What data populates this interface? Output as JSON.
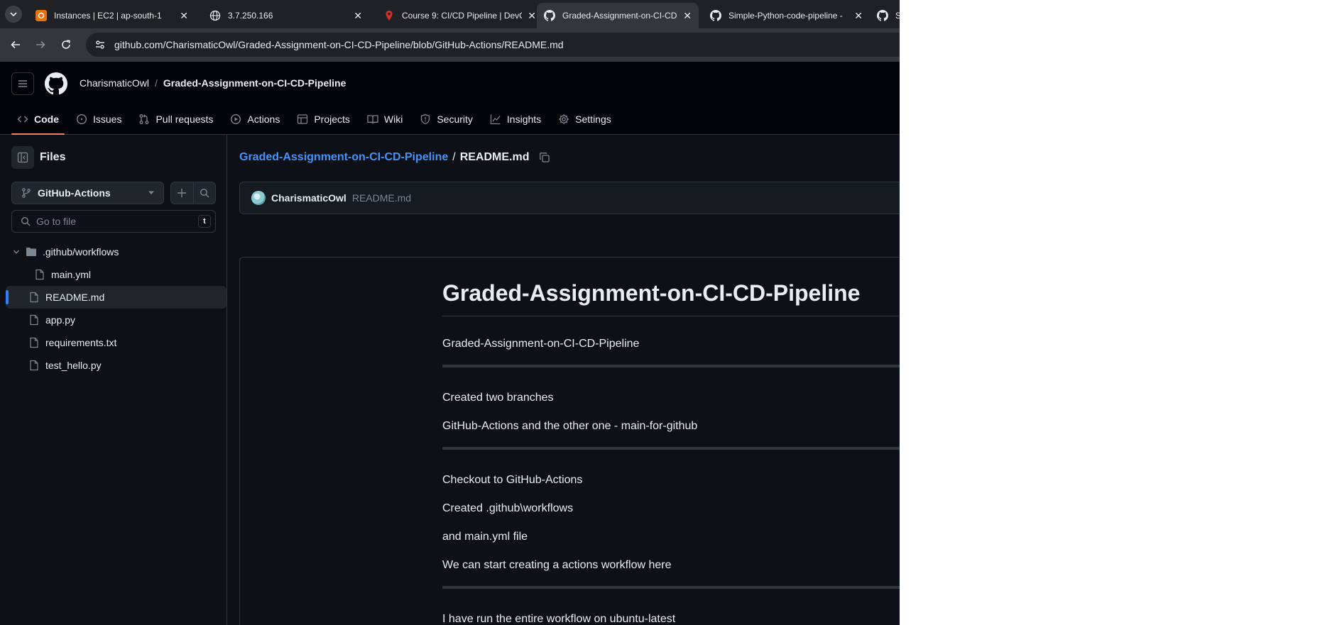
{
  "browser": {
    "tabs": [
      {
        "title": "Instances | EC2 | ap-south-1",
        "favicon": "aws-icon",
        "active": false
      },
      {
        "title": "3.7.250.166",
        "favicon": "globe-icon",
        "active": false
      },
      {
        "title": "Course 9: CI/CD Pipeline | DevO",
        "favicon": "pin-icon",
        "active": false
      },
      {
        "title": "Graded-Assignment-on-CI-CD-",
        "favicon": "github-icon",
        "active": true
      },
      {
        "title": "Simple-Python-code-pipeline -",
        "favicon": "github-icon",
        "active": false
      },
      {
        "title": "Si",
        "favicon": "github-icon",
        "active": false
      }
    ],
    "url": "github.com/CharismaticOwl/Graded-Assignment-on-CI-CD-Pipeline/blob/GitHub-Actions/README.md"
  },
  "header": {
    "owner": "CharismaticOwl",
    "separator": "/",
    "repo": "Graded-Assignment-on-CI-CD-Pipeline"
  },
  "nav": [
    {
      "label": "Code",
      "icon": "code-icon",
      "selected": true
    },
    {
      "label": "Issues",
      "icon": "issue-icon"
    },
    {
      "label": "Pull requests",
      "icon": "pull-request-icon"
    },
    {
      "label": "Actions",
      "icon": "play-icon"
    },
    {
      "label": "Projects",
      "icon": "table-icon"
    },
    {
      "label": "Wiki",
      "icon": "book-icon"
    },
    {
      "label": "Security",
      "icon": "shield-icon"
    },
    {
      "label": "Insights",
      "icon": "graph-icon"
    },
    {
      "label": "Settings",
      "icon": "gear-icon"
    }
  ],
  "sidebar": {
    "title": "Files",
    "branch": "GitHub-Actions",
    "search_placeholder": "Go to file",
    "search_shortcut": "t",
    "tree": [
      {
        "name": ".github/workflows",
        "type": "folder",
        "depth": 0,
        "expanded": true
      },
      {
        "name": "main.yml",
        "type": "file",
        "depth": 1
      },
      {
        "name": "README.md",
        "type": "file",
        "depth": 0,
        "selected": true
      },
      {
        "name": "app.py",
        "type": "file",
        "depth": 0
      },
      {
        "name": "requirements.txt",
        "type": "file",
        "depth": 0
      },
      {
        "name": "test_hello.py",
        "type": "file",
        "depth": 0
      }
    ]
  },
  "main": {
    "breadcrumb_repo": "Graded-Assignment-on-CI-CD-Pipeline",
    "breadcrumb_sep": "/",
    "breadcrumb_file": "README.md",
    "commit_author": "CharismaticOwl",
    "commit_file": "README.md"
  },
  "readme": {
    "title": "Graded-Assignment-on-CI-CD-Pipeline",
    "p1": "Graded-Assignment-on-CI-CD-Pipeline",
    "p2": "Created two branches",
    "p3": "GitHub-Actions and the other one - main-for-github",
    "p4": "Checkout to GitHub-Actions",
    "p5": "Created .github\\workflows",
    "p6": "and main.yml file",
    "p7": "We can start creating a actions workflow here",
    "p8": "I have run the entire workflow on ubuntu-latest"
  },
  "colors": {
    "bg": "#0d1117",
    "header_bg": "#010409",
    "link": "#4493f8",
    "border": "#30363d",
    "tab_underline": "#f78166"
  }
}
